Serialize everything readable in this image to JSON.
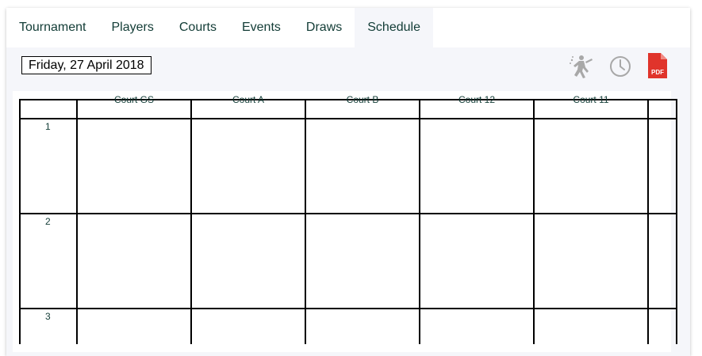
{
  "tabs": [
    {
      "label": "Tournament",
      "active": false
    },
    {
      "label": "Players",
      "active": false
    },
    {
      "label": "Courts",
      "active": false
    },
    {
      "label": "Events",
      "active": false
    },
    {
      "label": "Draws",
      "active": false
    },
    {
      "label": "Schedule",
      "active": true
    }
  ],
  "toolbar": {
    "date": "Friday, 27 April 2018",
    "icons": [
      "player-icon",
      "clock-icon",
      "pdf-icon"
    ],
    "pdf_label": "PDF"
  },
  "schedule": {
    "columns": [
      "Court GS",
      "Court A",
      "Court B",
      "Court 12",
      "Court 11"
    ],
    "rows": [
      "1",
      "2",
      "3"
    ]
  },
  "colors": {
    "tab_text": "#123c36",
    "background": "#f5f6fa",
    "pdf_red": "#e0342b",
    "icon_gray": "#a8a8a8"
  }
}
